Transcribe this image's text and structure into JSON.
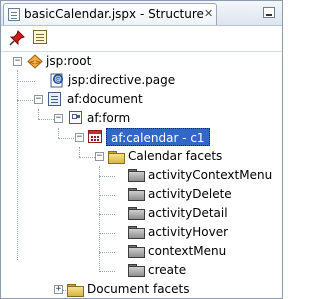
{
  "tab": {
    "title": "basicCalendar.jspx - Structure",
    "close_glyph": "✕",
    "icon": "structure-icon"
  },
  "window": {
    "minimize_icon": "minimize-icon"
  },
  "toolbar": {
    "pin_icon": "pin-icon",
    "properties_icon": "properties-icon"
  },
  "tree": {
    "nodes": [
      {
        "label": "jsp:root",
        "icon": "jsp-root-icon",
        "expanded": true
      },
      {
        "label": "jsp:directive.page",
        "icon": "directive-icon"
      },
      {
        "label": "af:document",
        "icon": "document-icon",
        "expanded": true
      },
      {
        "label": "af:form",
        "icon": "form-icon",
        "expanded": true
      },
      {
        "label": "af:calendar - c1",
        "icon": "calendar-icon",
        "expanded": true,
        "selected": true
      },
      {
        "label": "Calendar facets",
        "icon": "folder-icon",
        "expanded": true
      },
      {
        "label": "activityContextMenu",
        "icon": "facet-icon"
      },
      {
        "label": "activityDelete",
        "icon": "facet-icon"
      },
      {
        "label": "activityDetail",
        "icon": "facet-icon"
      },
      {
        "label": "activityHover",
        "icon": "facet-icon"
      },
      {
        "label": "contextMenu",
        "icon": "facet-icon"
      },
      {
        "label": "create",
        "icon": "facet-icon"
      },
      {
        "label": "Document facets",
        "icon": "folder-icon",
        "expanded": false
      }
    ],
    "expander_minus": "−",
    "expander_plus": "+"
  },
  "colors": {
    "selection": "#3167c6",
    "folder": "#e6c65a",
    "calendar_red": "#c03030"
  }
}
